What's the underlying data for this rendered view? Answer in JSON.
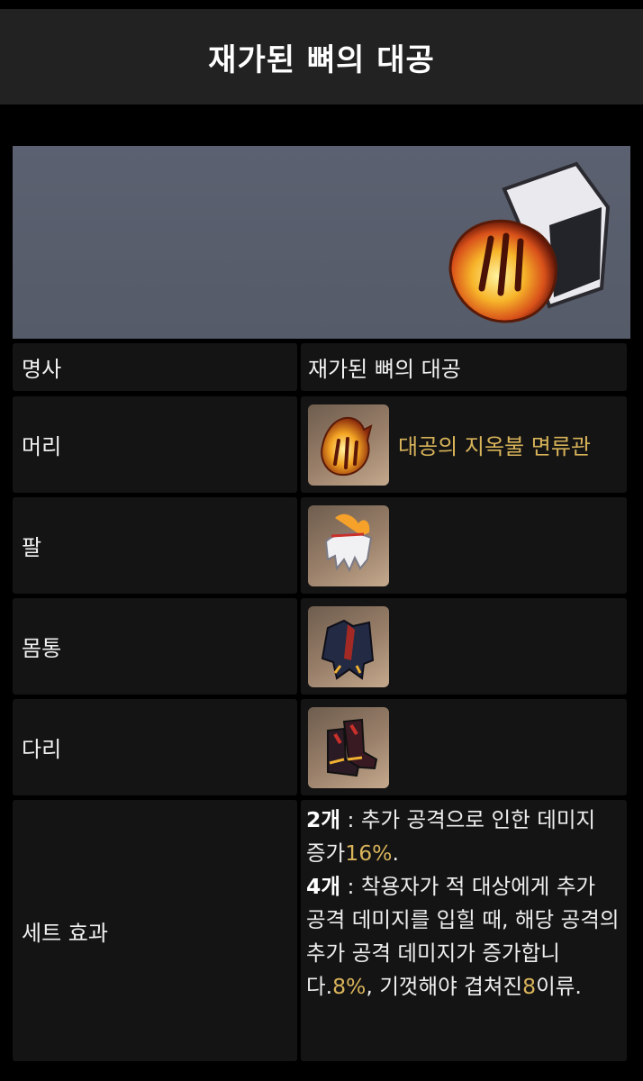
{
  "title": "재가된 뼈의 대공",
  "banner": {
    "icon": "relic-set-icon"
  },
  "rows": [
    {
      "label": "명사",
      "value": "재가된 뼈의 대공"
    },
    {
      "label": "머리",
      "piece_name": "대공의 지옥불 면류관",
      "icon": "crown-icon"
    },
    {
      "label": "팔",
      "piece_name": "",
      "icon": "gloves-icon"
    },
    {
      "label": "몸통",
      "piece_name": "",
      "icon": "coat-icon"
    },
    {
      "label": "다리",
      "piece_name": "",
      "icon": "boots-icon"
    },
    {
      "label": "세트 효과"
    }
  ],
  "set_effect": {
    "two": {
      "count": "2개",
      "text1": " : 추가 공격으로 인한 데미지 증가",
      "value": "16%",
      "text2": "."
    },
    "four": {
      "count": "4개",
      "text1": " : 착용자가 적 대상에게 추가 공격 데미지를 입힐 때, 해당 공격의 추가 공격 데미지가 증가합니다.",
      "value1": "8%",
      "text2": ", 기껏해야 겹쳐진",
      "value2": "8",
      "text3": "이류."
    }
  },
  "colors": {
    "accent_gold": "#d8b35a",
    "header_bg": "#222222",
    "cell_bg": "#141414"
  }
}
